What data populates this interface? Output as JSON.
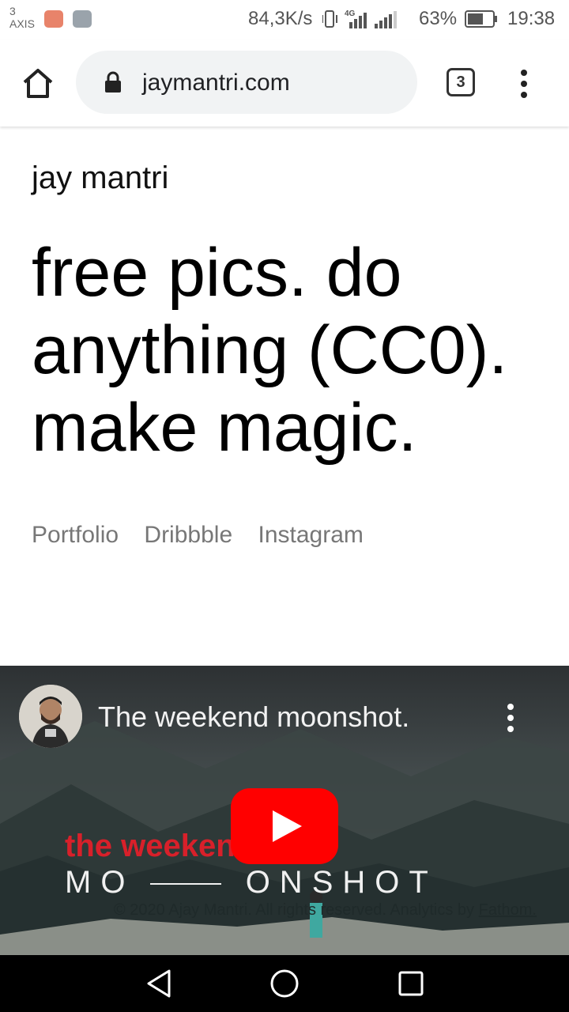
{
  "status_bar": {
    "carrier_top": "3",
    "carrier_bottom": "AXIS",
    "net_speed": "84,3K/s",
    "network_type": "4G",
    "battery_percent": "63%",
    "battery_level": 0.63,
    "time": "19:38",
    "icons": [
      "mail-app-icon",
      "gallery-app-icon",
      "vibrate-icon",
      "signal-icon",
      "battery-icon"
    ]
  },
  "browser": {
    "url": "jaymantri.com",
    "tab_count": "3"
  },
  "page": {
    "site_title": "jay mantri",
    "headline_lines": [
      "free pics. do",
      "anything (CC0).",
      "make magic."
    ],
    "nav_links": [
      "Portfolio",
      "Dribbble",
      "Instagram"
    ]
  },
  "video": {
    "title": "The weekend moonshot.",
    "overlay_text_1": "the weeken",
    "overlay_text_2": "MO",
    "overlay_text_3": "ONSHOT",
    "footer_text": "© 2020 Ajay Mantri. All rights reserved. Analytics by",
    "footer_link": "Fathom."
  },
  "colors": {
    "youtube_red": "#ff0000",
    "brand_red": "#d8202a",
    "link_gray": "#777777",
    "omnibox_bg": "#f1f3f4"
  }
}
